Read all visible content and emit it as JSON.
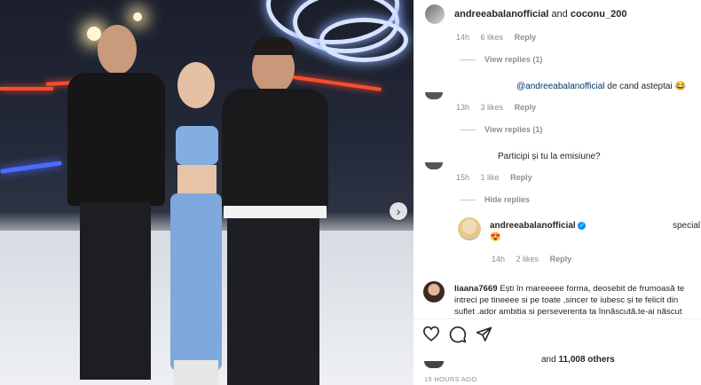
{
  "post": {
    "author": "andreeabalanofficial",
    "coauthor_joiner": "and",
    "coauthor": "coconu_200"
  },
  "comments": [
    {
      "meta": {
        "time": "14h",
        "likes": "6 likes",
        "reply": "Reply"
      },
      "view_replies": "View replies (1)"
    },
    {
      "mention": "@andreeabalanofficial",
      "text": "de cand asteptai",
      "emoji": "😂",
      "meta": {
        "time": "13h",
        "likes": "3 likes",
        "reply": "Reply"
      },
      "view_replies": "View replies (1)"
    },
    {
      "text": "Participi și tu la emisiune?",
      "meta": {
        "time": "15h",
        "likes": "1 like",
        "reply": "Reply"
      },
      "view_replies": "Hide replies"
    },
    {
      "author": "andreeabalanofficial",
      "verified_icon": "verified-badge-icon",
      "trailing": "special",
      "emoji": "😍",
      "meta": {
        "time": "14h",
        "likes": "2 likes",
        "reply": "Reply"
      }
    },
    {
      "author": "liaana7669",
      "text_lines": [
        "Ești în mareeeee forma, deosebit de frumoasă te",
        "intreci pe tineeee si pe toate ,sincer te iubesc și te felicit din",
        "suflet .ador ambitia si perseverenta ta înnăscută.te-ai născut"
      ]
    }
  ],
  "actions": {
    "like_icon": "heart-icon",
    "comment_icon": "comment-icon",
    "share_icon": "share-icon"
  },
  "likes_line": {
    "prefix": "and",
    "count": "11,008 others"
  },
  "timestamp": "15 HOURS AGO",
  "colors": {
    "text": "#262626",
    "muted": "#8e8e8e",
    "mention": "#00376b",
    "verified": "#0095f6"
  }
}
